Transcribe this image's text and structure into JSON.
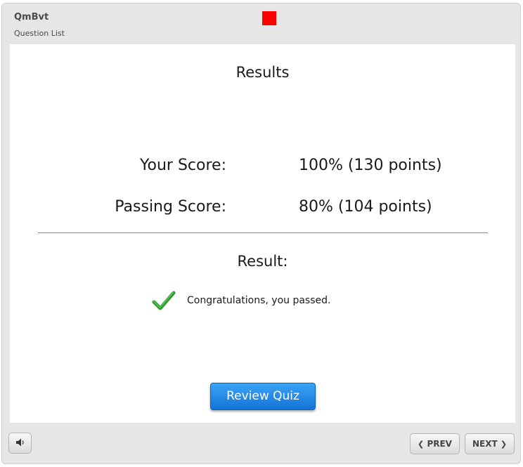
{
  "header": {
    "title": "QmBvt",
    "subtitle": "Question List",
    "indicator_color": "#ff0000"
  },
  "results": {
    "title": "Results",
    "your_score_label": "Your Score:",
    "your_score_value": "100% (130 points)",
    "passing_score_label": "Passing Score:",
    "passing_score_value": "80% (104 points)",
    "result_label": "Result:",
    "result_icon": "checkmark-icon",
    "result_icon_color": "#2e9a2e",
    "result_message": "Congratulations, you passed."
  },
  "actions": {
    "review_label": "Review Quiz",
    "review_color": "#1f8aeb"
  },
  "footer": {
    "audio_icon": "speaker-icon",
    "prev_label": "PREV",
    "next_label": "NEXT"
  }
}
